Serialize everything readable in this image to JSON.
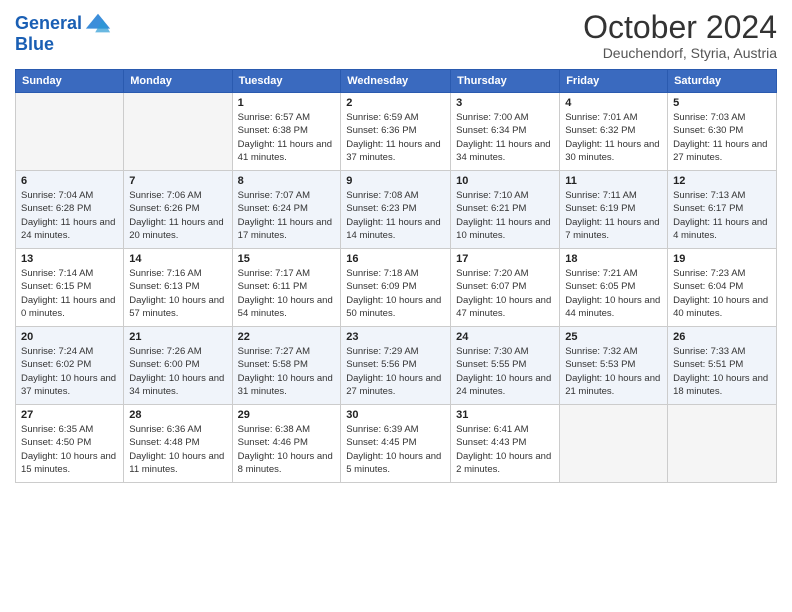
{
  "header": {
    "logo_line1": "General",
    "logo_line2": "Blue",
    "month": "October 2024",
    "location": "Deuchendorf, Styria, Austria"
  },
  "days_of_week": [
    "Sunday",
    "Monday",
    "Tuesday",
    "Wednesday",
    "Thursday",
    "Friday",
    "Saturday"
  ],
  "weeks": [
    [
      {
        "day": "",
        "empty": true
      },
      {
        "day": "",
        "empty": true
      },
      {
        "day": "1",
        "sunrise": "6:57 AM",
        "sunset": "6:38 PM",
        "daylight": "11 hours and 41 minutes."
      },
      {
        "day": "2",
        "sunrise": "6:59 AM",
        "sunset": "6:36 PM",
        "daylight": "11 hours and 37 minutes."
      },
      {
        "day": "3",
        "sunrise": "7:00 AM",
        "sunset": "6:34 PM",
        "daylight": "11 hours and 34 minutes."
      },
      {
        "day": "4",
        "sunrise": "7:01 AM",
        "sunset": "6:32 PM",
        "daylight": "11 hours and 30 minutes."
      },
      {
        "day": "5",
        "sunrise": "7:03 AM",
        "sunset": "6:30 PM",
        "daylight": "11 hours and 27 minutes."
      }
    ],
    [
      {
        "day": "6",
        "sunrise": "7:04 AM",
        "sunset": "6:28 PM",
        "daylight": "11 hours and 24 minutes."
      },
      {
        "day": "7",
        "sunrise": "7:06 AM",
        "sunset": "6:26 PM",
        "daylight": "11 hours and 20 minutes."
      },
      {
        "day": "8",
        "sunrise": "7:07 AM",
        "sunset": "6:24 PM",
        "daylight": "11 hours and 17 minutes."
      },
      {
        "day": "9",
        "sunrise": "7:08 AM",
        "sunset": "6:23 PM",
        "daylight": "11 hours and 14 minutes."
      },
      {
        "day": "10",
        "sunrise": "7:10 AM",
        "sunset": "6:21 PM",
        "daylight": "11 hours and 10 minutes."
      },
      {
        "day": "11",
        "sunrise": "7:11 AM",
        "sunset": "6:19 PM",
        "daylight": "11 hours and 7 minutes."
      },
      {
        "day": "12",
        "sunrise": "7:13 AM",
        "sunset": "6:17 PM",
        "daylight": "11 hours and 4 minutes."
      }
    ],
    [
      {
        "day": "13",
        "sunrise": "7:14 AM",
        "sunset": "6:15 PM",
        "daylight": "11 hours and 0 minutes."
      },
      {
        "day": "14",
        "sunrise": "7:16 AM",
        "sunset": "6:13 PM",
        "daylight": "10 hours and 57 minutes."
      },
      {
        "day": "15",
        "sunrise": "7:17 AM",
        "sunset": "6:11 PM",
        "daylight": "10 hours and 54 minutes."
      },
      {
        "day": "16",
        "sunrise": "7:18 AM",
        "sunset": "6:09 PM",
        "daylight": "10 hours and 50 minutes."
      },
      {
        "day": "17",
        "sunrise": "7:20 AM",
        "sunset": "6:07 PM",
        "daylight": "10 hours and 47 minutes."
      },
      {
        "day": "18",
        "sunrise": "7:21 AM",
        "sunset": "6:05 PM",
        "daylight": "10 hours and 44 minutes."
      },
      {
        "day": "19",
        "sunrise": "7:23 AM",
        "sunset": "6:04 PM",
        "daylight": "10 hours and 40 minutes."
      }
    ],
    [
      {
        "day": "20",
        "sunrise": "7:24 AM",
        "sunset": "6:02 PM",
        "daylight": "10 hours and 37 minutes."
      },
      {
        "day": "21",
        "sunrise": "7:26 AM",
        "sunset": "6:00 PM",
        "daylight": "10 hours and 34 minutes."
      },
      {
        "day": "22",
        "sunrise": "7:27 AM",
        "sunset": "5:58 PM",
        "daylight": "10 hours and 31 minutes."
      },
      {
        "day": "23",
        "sunrise": "7:29 AM",
        "sunset": "5:56 PM",
        "daylight": "10 hours and 27 minutes."
      },
      {
        "day": "24",
        "sunrise": "7:30 AM",
        "sunset": "5:55 PM",
        "daylight": "10 hours and 24 minutes."
      },
      {
        "day": "25",
        "sunrise": "7:32 AM",
        "sunset": "5:53 PM",
        "daylight": "10 hours and 21 minutes."
      },
      {
        "day": "26",
        "sunrise": "7:33 AM",
        "sunset": "5:51 PM",
        "daylight": "10 hours and 18 minutes."
      }
    ],
    [
      {
        "day": "27",
        "sunrise": "6:35 AM",
        "sunset": "4:50 PM",
        "daylight": "10 hours and 15 minutes."
      },
      {
        "day": "28",
        "sunrise": "6:36 AM",
        "sunset": "4:48 PM",
        "daylight": "10 hours and 11 minutes."
      },
      {
        "day": "29",
        "sunrise": "6:38 AM",
        "sunset": "4:46 PM",
        "daylight": "10 hours and 8 minutes."
      },
      {
        "day": "30",
        "sunrise": "6:39 AM",
        "sunset": "4:45 PM",
        "daylight": "10 hours and 5 minutes."
      },
      {
        "day": "31",
        "sunrise": "6:41 AM",
        "sunset": "4:43 PM",
        "daylight": "10 hours and 2 minutes."
      },
      {
        "day": "",
        "empty": true
      },
      {
        "day": "",
        "empty": true
      }
    ]
  ]
}
